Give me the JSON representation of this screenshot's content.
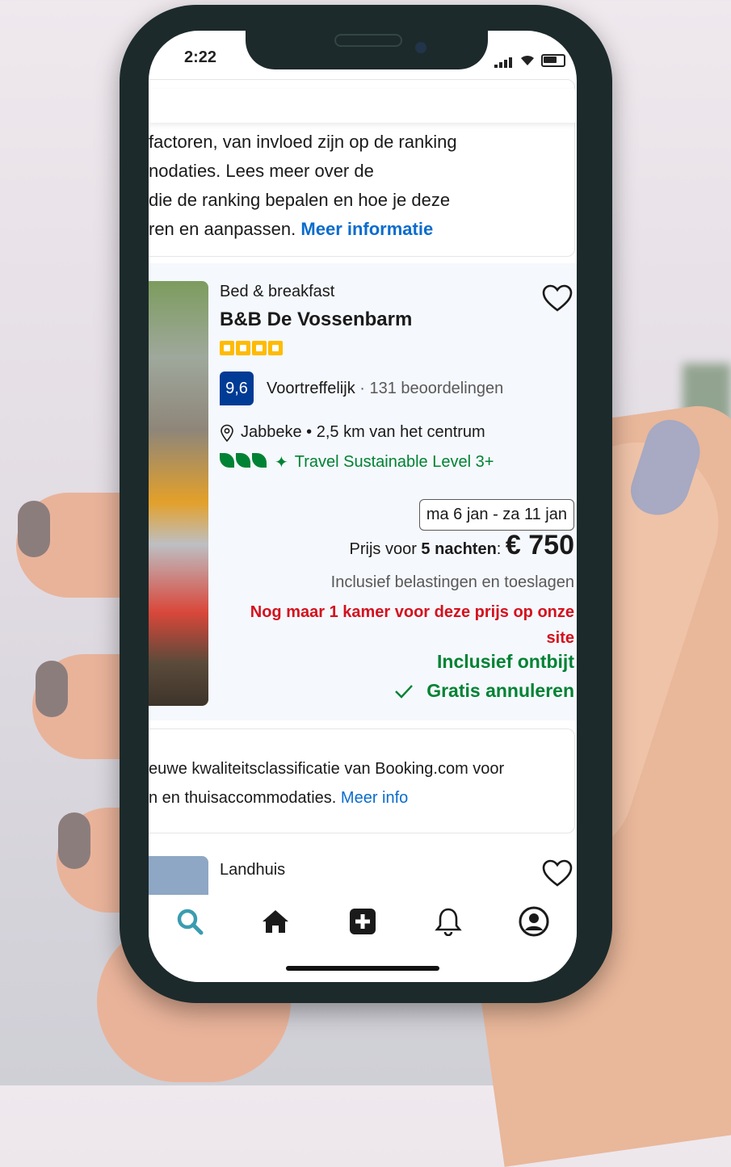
{
  "status_bar": {
    "time": "2:22"
  },
  "info": {
    "lines": [
      "factoren, van invloed zijn op de ranking",
      "nodaties. Lees meer over de",
      "die de ranking bepalen en hoe je deze"
    ],
    "last_line": "ren en aanpassen.",
    "link": "Meer informatie"
  },
  "property": {
    "type": "Bed & breakfast",
    "name": "B&B De Vossenbarm",
    "stars": 4,
    "score": "9,6",
    "score_label": "Voortreffelijk",
    "separator": "·",
    "reviews": "131 beoordelingen",
    "location": "Jabbeke • 2,5 km van het centrum",
    "sustainability": "Travel Sustainable Level 3+",
    "dates": "ma 6 jan - za 11 jan",
    "price_prefix": "Prijs voor",
    "nights": "5 nachten",
    "price_colon": ":",
    "price": "€ 750",
    "taxes": "Inclusief belastingen en toeslagen",
    "scarcity": "Nog maar 1 kamer voor deze prijs op onze site",
    "breakfast": "Inclusief ontbijt",
    "cancellation": "Gratis annuleren"
  },
  "quality": {
    "line1": "euwe kwaliteitsclassificatie van Booking.com voor",
    "line2": "n en thuisaccommodaties.",
    "link": "Meer info"
  },
  "next_property": {
    "type": "Landhuis"
  },
  "colors": {
    "link": "#0a6ccd",
    "score_bg": "#003b95",
    "star": "#febb02",
    "green": "#008234",
    "red": "#d4111e",
    "search_active": "#3a9cb0"
  },
  "nav": {
    "items": [
      "search-icon",
      "home-icon",
      "add-icon",
      "bell-icon",
      "profile-icon"
    ]
  }
}
